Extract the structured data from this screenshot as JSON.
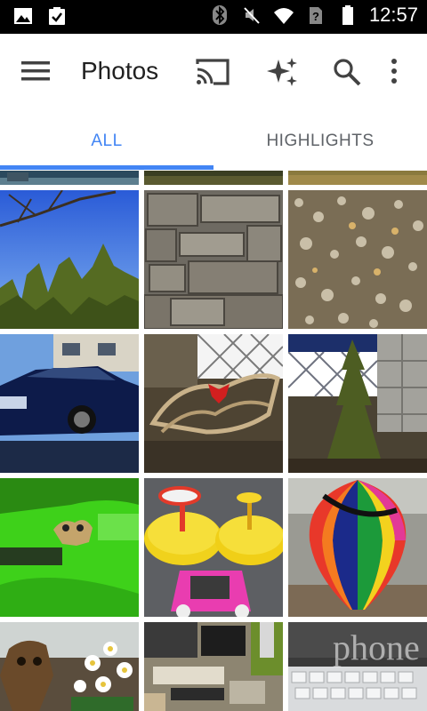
{
  "status_bar": {
    "time": "12:57",
    "icons_left": [
      "gallery-icon",
      "clipboard-check-icon"
    ],
    "icons_right": [
      "bluetooth-icon",
      "vibrate-off-icon",
      "wifi-icon",
      "no-sim-icon",
      "battery-icon"
    ]
  },
  "app_bar": {
    "title": "Photos",
    "actions": [
      "menu-icon",
      "cast-icon",
      "assistant-icon",
      "search-icon",
      "more-icon"
    ]
  },
  "tabs": [
    {
      "label": "ALL",
      "selected": true
    },
    {
      "label": "HIGHLIGHTS",
      "selected": false
    }
  ],
  "colors": {
    "accent": "#4285f4",
    "title": "#212121",
    "tab_inactive": "#5f6368"
  },
  "photos": [
    {
      "row": 0,
      "col": 0,
      "subject": "water"
    },
    {
      "row": 0,
      "col": 1,
      "subject": "ground"
    },
    {
      "row": 0,
      "col": 2,
      "subject": "grass"
    },
    {
      "row": 1,
      "col": 0,
      "subject": "trees-and-sky"
    },
    {
      "row": 1,
      "col": 1,
      "subject": "stone-wall"
    },
    {
      "row": 1,
      "col": 2,
      "subject": "gravel"
    },
    {
      "row": 2,
      "col": 0,
      "subject": "blue-car"
    },
    {
      "row": 2,
      "col": 1,
      "subject": "reindeer-decoration"
    },
    {
      "row": 2,
      "col": 2,
      "subject": "small-evergreen"
    },
    {
      "row": 3,
      "col": 0,
      "subject": "green-sled-with-toy"
    },
    {
      "row": 3,
      "col": 1,
      "subject": "spinning-toys"
    },
    {
      "row": 3,
      "col": 2,
      "subject": "hot-air-balloon"
    },
    {
      "row": 4,
      "col": 0,
      "subject": "figurine-and-flowers"
    },
    {
      "row": 4,
      "col": 1,
      "subject": "desk"
    },
    {
      "row": 4,
      "col": 2,
      "subject": "keyboard"
    }
  ],
  "watermark": "phone scoop"
}
